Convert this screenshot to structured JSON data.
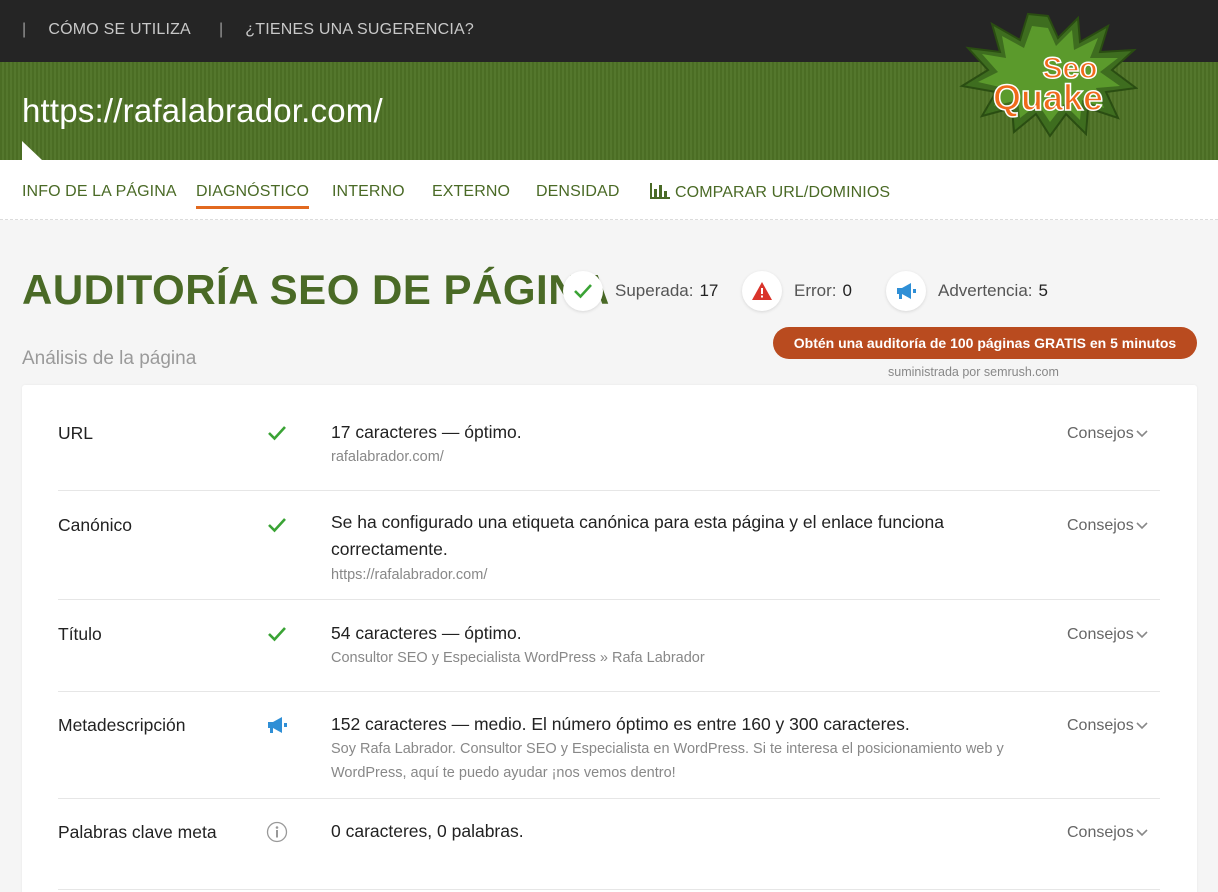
{
  "topnav": {
    "sep": "|",
    "how_to": "CÓMO SE UTILIZA",
    "suggestion": "¿TIENES UNA SUGERENCIA?"
  },
  "header": {
    "url": "https://rafalabrador.com/"
  },
  "logo": {
    "text_top": "Seo",
    "text_bottom": "Quake"
  },
  "tabs": [
    {
      "label": "INFO DE LA PÁGINA"
    },
    {
      "label": "DIAGNÓSTICO"
    },
    {
      "label": "INTERNO"
    },
    {
      "label": "EXTERNO"
    },
    {
      "label": "DENSIDAD"
    },
    {
      "label": "COMPARAR URL/DOMINIOS",
      "icon": "bar-chart-icon"
    }
  ],
  "active_tab": "DIAGNÓSTICO",
  "title": "AUDITORÍA SEO DE PÁGINA",
  "stats": {
    "passed": {
      "label": "Superada:",
      "value": "17",
      "icon": "check-icon"
    },
    "error": {
      "label": "Error:",
      "value": "0",
      "icon": "warning-icon"
    },
    "warning": {
      "label": "Advertencia:",
      "value": "5",
      "icon": "megaphone-icon"
    }
  },
  "promo": {
    "label": "Obtén una auditoría de 100 páginas GRATIS en 5 minutos",
    "supplied_by": "suministrada por  semrush.com"
  },
  "subtitle": "Análisis de la página",
  "colors": {
    "green": "#4a6a26",
    "check": "#3aa335",
    "error": "#d9342b",
    "warning": "#2f8fd6",
    "promo": "#b94b1f",
    "tab_underline": "#e2691f"
  },
  "rows": [
    {
      "name": "URL",
      "status": "check-icon",
      "main": "17 caracteres — óptimo.",
      "sub": "rafalabrador.com/",
      "tips": "Consejos"
    },
    {
      "name": "Canónico",
      "status": "check-icon",
      "main": "Se ha configurado una etiqueta canónica para esta página y el enlace funciona correctamente.",
      "sub": "https://rafalabrador.com/",
      "tips": "Consejos"
    },
    {
      "name": "Título",
      "status": "check-icon",
      "main": "54 caracteres — óptimo.",
      "sub": "Consultor SEO y Especialista WordPress » Rafa Labrador",
      "tips": "Consejos"
    },
    {
      "name": "Metadescripción",
      "status": "megaphone-icon",
      "main": "152 caracteres — medio. El número óptimo es entre 160 y 300 caracteres.",
      "sub": "Soy Rafa Labrador. Consultor SEO y Especialista en WordPress. Si te interesa el posicionamiento web y WordPress, aquí te puedo ayudar ¡nos vemos dentro!",
      "tips": "Consejos"
    },
    {
      "name": "Palabras clave meta",
      "status": "info-icon",
      "main": "0 caracteres, 0 palabras.",
      "sub": "",
      "tips": "Consejos"
    }
  ]
}
